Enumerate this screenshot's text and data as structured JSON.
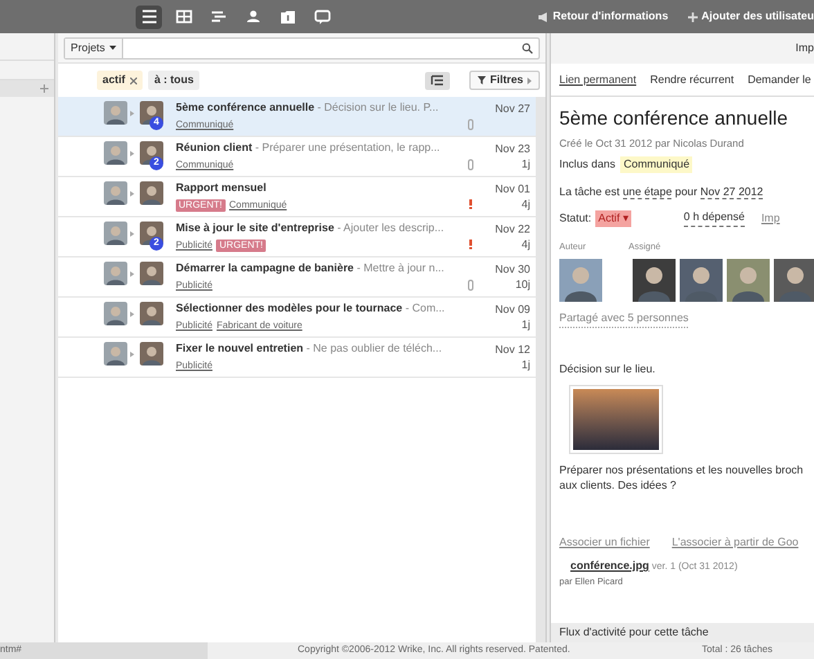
{
  "top_bar": {
    "nav_icons": [
      {
        "kind": "list",
        "selected": true
      },
      {
        "kind": "grid",
        "selected": false
      },
      {
        "kind": "gantt",
        "selected": false
      },
      {
        "kind": "person",
        "selected": false
      },
      {
        "kind": "info",
        "selected": false
      },
      {
        "kind": "chat",
        "selected": false
      }
    ],
    "links": [
      "Retour d'informations",
      "Ajouter des utilisateu"
    ]
  },
  "search": {
    "scope": "Projets"
  },
  "right_header": "Imp",
  "filters": {
    "chips": [
      {
        "label": "actif",
        "removable": true
      },
      {
        "label": "à : tous",
        "removable": false
      }
    ],
    "button": "Filtres"
  },
  "tasks": [
    {
      "title": "5ème conférence annuelle",
      "description": " - Décision sur le lieu. P...",
      "tags": [
        {
          "kind": "folder",
          "label": "Communiqué"
        }
      ],
      "date": "Nov 27",
      "attachment": true,
      "important": false,
      "badge": "4",
      "selected": true
    },
    {
      "title": "Réunion client",
      "description": " - Préparer une présentation, le rapp...",
      "tags": [
        {
          "kind": "folder",
          "label": "Communiqué"
        }
      ],
      "date": "Nov 23",
      "duration": "1j",
      "attachment": true,
      "important": false,
      "badge": "2",
      "selected": false
    },
    {
      "title": "Rapport mensuel",
      "tags": [
        {
          "kind": "urgent",
          "label": "URGENT!"
        },
        {
          "kind": "folder",
          "label": "Communiqué"
        }
      ],
      "date": "Nov 01",
      "duration": "4j",
      "attachment": false,
      "important": true,
      "selected": false
    },
    {
      "title": "Mise à jour le site d'entreprise",
      "description": " - Ajouter les descrip...",
      "tags": [
        {
          "kind": "folder",
          "label": "Publicité"
        },
        {
          "kind": "urgent",
          "label": "URGENT!"
        }
      ],
      "date": "Nov 22",
      "duration": "4j",
      "attachment": false,
      "important": true,
      "badge": "2",
      "selected": false
    },
    {
      "title": "Démarrer la campagne de banière",
      "description": " - Mettre à jour n...",
      "tags": [
        {
          "kind": "folder",
          "label": "Publicité"
        }
      ],
      "date": "Nov 30",
      "duration": "10j",
      "attachment": true,
      "important": false,
      "selected": false
    },
    {
      "title": "Sélectionner des modèles pour le tournace",
      "description": " - Com...",
      "tags": [
        {
          "kind": "folder",
          "label": "Publicité"
        },
        {
          "kind": "folder",
          "label": "Fabricant de voiture"
        }
      ],
      "date": "Nov 09",
      "duration": "1j",
      "attachment": false,
      "important": false,
      "selected": false
    },
    {
      "title": "Fixer le nouvel entretien",
      "description": " - Ne pas oublier de téléch...",
      "tags": [
        {
          "kind": "folder",
          "label": "Publicité"
        }
      ],
      "date": "Nov 12",
      "duration": "1j",
      "attachment": false,
      "important": false,
      "selected": false
    }
  ],
  "detail": {
    "actions": [
      "Lien permanent",
      "Rendre récurrent",
      "Demander le"
    ],
    "title": "5ème conférence annuelle",
    "created": "Créé le Oct 31 2012 par Nicolas Durand",
    "included_label": "Inclus dans",
    "folder": "Communiqué",
    "milestone": {
      "prefix": "La tâche est",
      "type": "une étape",
      "middle": "pour",
      "date": "Nov 27 2012"
    },
    "status_label": "Statut:",
    "status": "Actif ▾",
    "spent": "0 h dépensé",
    "importance": "Imp",
    "author_label": "Auteur",
    "assigned_label": "Assigné",
    "shared": "Partagé avec 5 personnes",
    "description_lines": [
      "Décision sur le lieu."
    ],
    "more_lines": [
      "Préparer nos présentations et les nouvelles broch",
      "aux clients. Des idées ?"
    ],
    "attach_links": [
      "Associer un fichier",
      "L'associer à partir de Goo"
    ],
    "file": {
      "name": "conférence.jpg",
      "meta": "ver. 1 (Oct 31 2012)",
      "by": "par Ellen Picard"
    },
    "activity": "Flux d'activité pour cette tâche"
  },
  "footer": {
    "left": "ntm#",
    "copyright": "Copyright ©2006-2012 Wrike, Inc. All rights reserved. Patented.",
    "total": "Total : 26 tâches"
  }
}
